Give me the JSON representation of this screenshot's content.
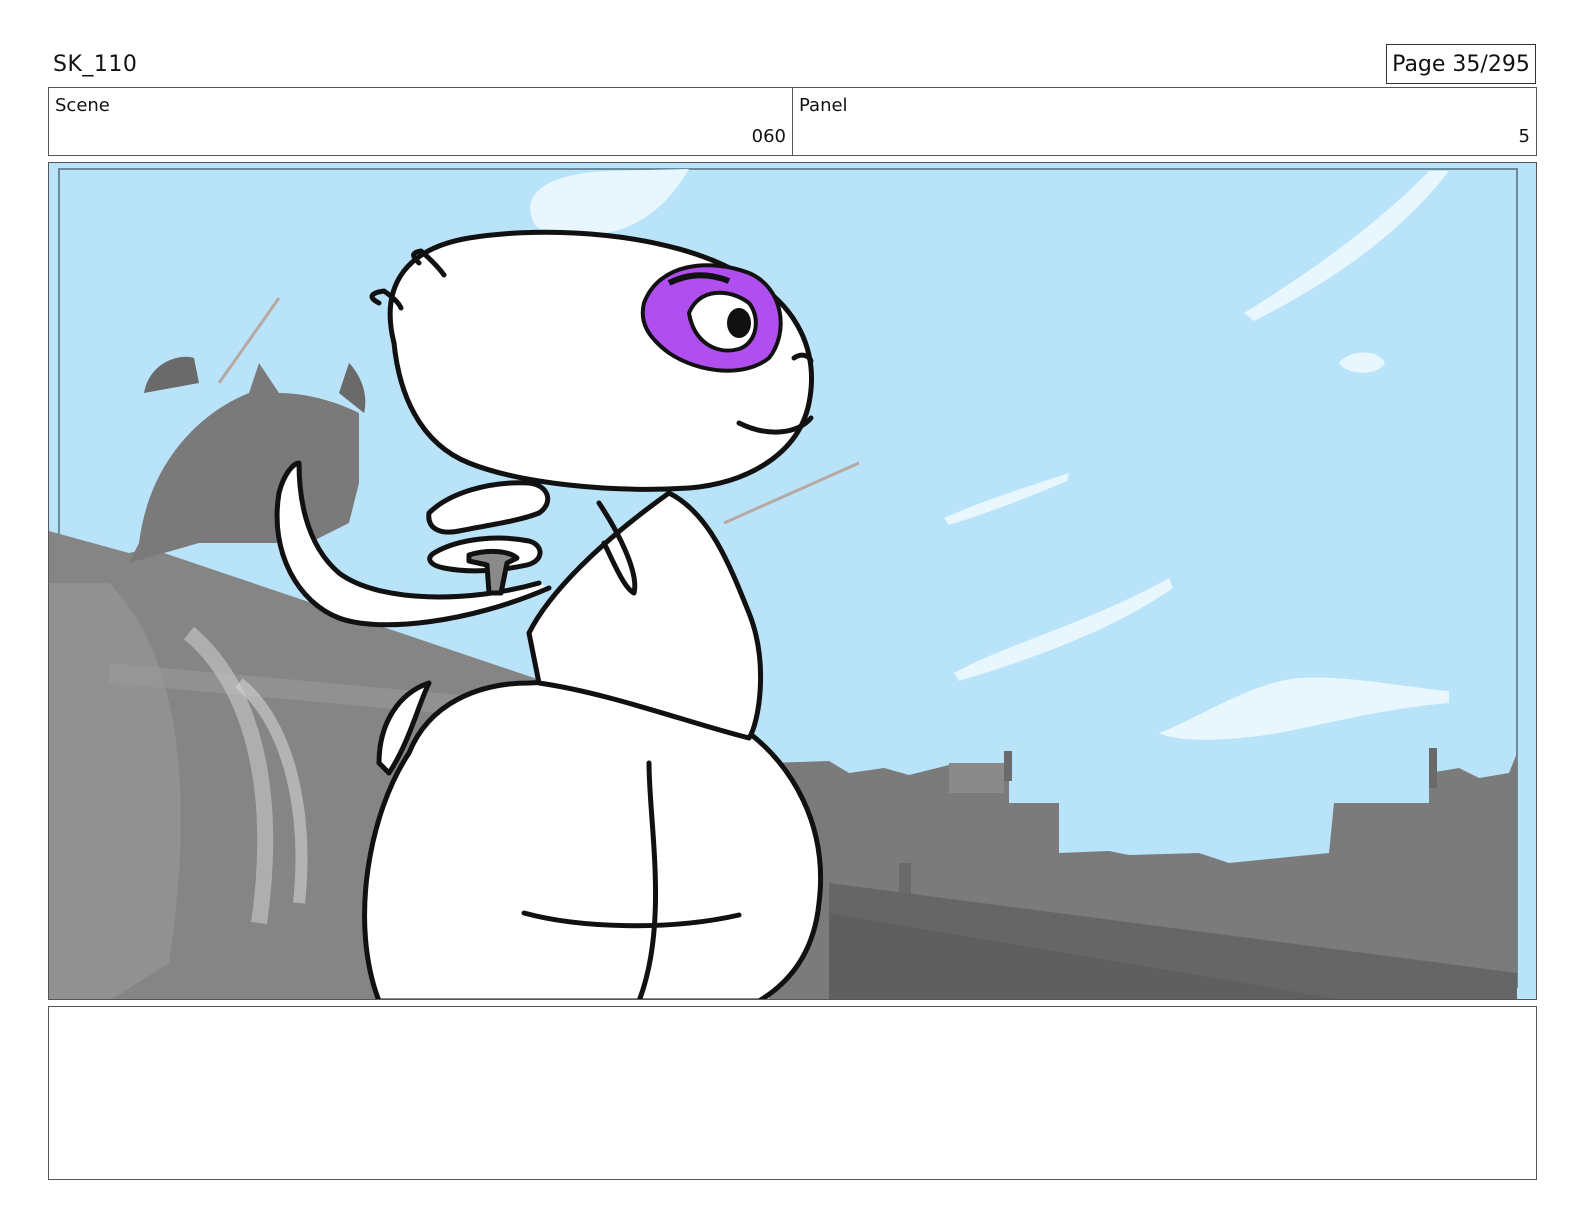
{
  "header": {
    "sheet_id": "SK_110",
    "page_label": "Page  35/295"
  },
  "info": {
    "scene_label": "Scene",
    "scene_value": "060",
    "panel_label": "Panel",
    "panel_value": "5"
  },
  "artwork": {
    "sky_color": "#b9e3f9",
    "building_color": "#7b7b7b",
    "eye_color": "#b04ef0",
    "character_color": "#ffffff"
  },
  "notes": {
    "text": ""
  }
}
